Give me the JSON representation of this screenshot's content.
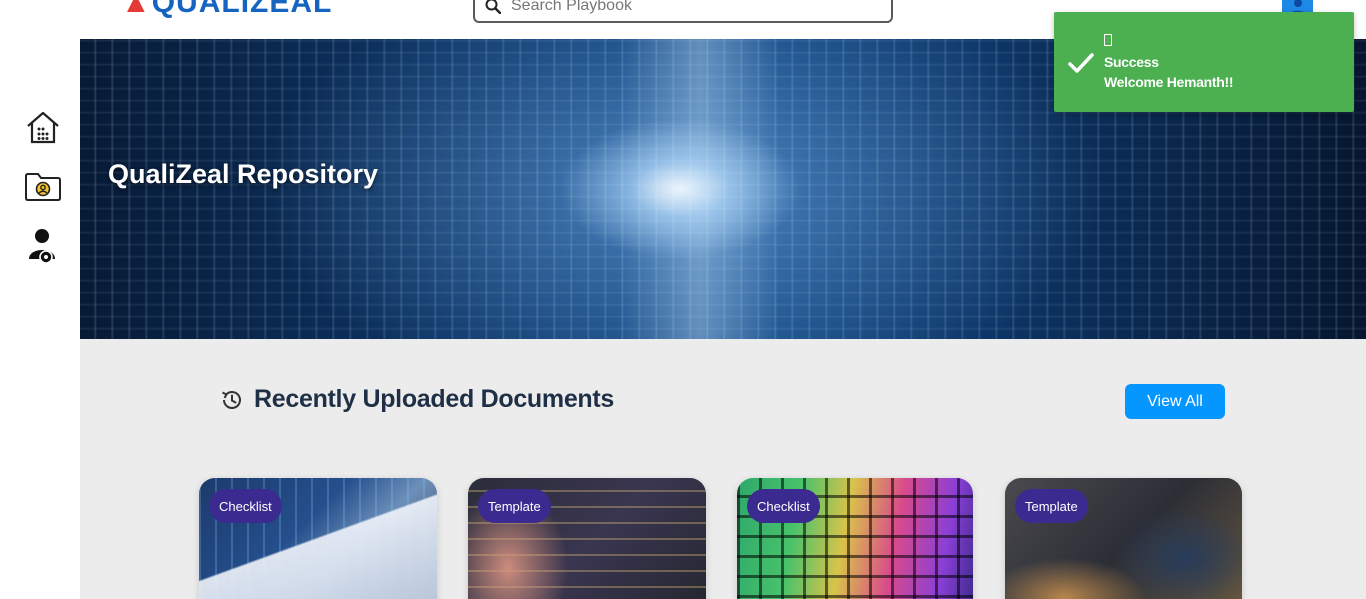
{
  "header": {
    "logo_text": "QUALIZEAL",
    "search": {
      "placeholder": "Search Playbook",
      "value": ""
    },
    "user_icon": "user-avatar-icon"
  },
  "sidebar": {
    "items": [
      {
        "icon": "home-icon"
      },
      {
        "icon": "user-folder-icon"
      },
      {
        "icon": "user-settings-icon"
      }
    ]
  },
  "banner": {
    "title": "QualiZeal Repository"
  },
  "toast": {
    "close_glyph": "",
    "title": "Success",
    "message": "Welcome Hemanth!!",
    "color": "#4caf50"
  },
  "main": {
    "section_icon": "history-icon",
    "section_title": "Recently Uploaded Documents",
    "view_all_label": "View All",
    "cards": [
      {
        "badge": "Checklist"
      },
      {
        "badge": "Template"
      },
      {
        "badge": "Checklist"
      },
      {
        "badge": "Template"
      }
    ]
  },
  "colors": {
    "accent": "#0596ff",
    "badge": "#3b2a8f",
    "heading": "#1f3046",
    "section_bg": "#ececec"
  }
}
